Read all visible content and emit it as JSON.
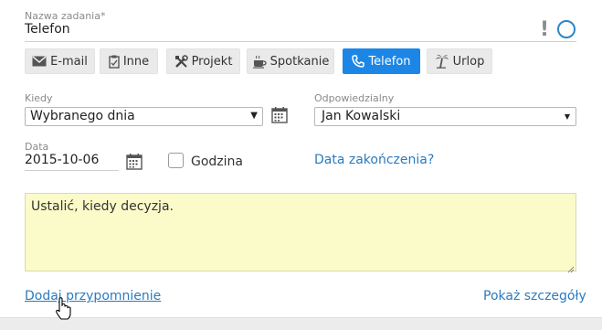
{
  "task": {
    "name_label": "Nazwa zadania*",
    "name_value": "Telefon",
    "priority_icon": "exclamation-icon",
    "status_icon": "circle-icon"
  },
  "types": [
    {
      "label": "E-mail",
      "icon": "envelope-icon",
      "active": false
    },
    {
      "label": "Inne",
      "icon": "clipboard-icon",
      "active": false
    },
    {
      "label": "Projekt",
      "icon": "tools-icon",
      "active": false
    },
    {
      "label": "Spotkanie",
      "icon": "coffee-icon",
      "active": false
    },
    {
      "label": "Telefon",
      "icon": "phone-icon",
      "active": true
    },
    {
      "label": "Urlop",
      "icon": "palm-tree-icon",
      "active": false
    }
  ],
  "when": {
    "label": "Kiedy",
    "value": "Wybranego dnia"
  },
  "responsible": {
    "label": "Odpowiedzialny",
    "value": "Jan Kowalski"
  },
  "date": {
    "label": "Data",
    "value": "2015-10-06"
  },
  "hour": {
    "label": "Godzina",
    "checked": false
  },
  "end_date_link": "Data zakończenia?",
  "note": "Ustalić, kiedy decyzja.",
  "links": {
    "add_reminder": "Dodaj przypomnienie",
    "show_details": "Pokaż szczegóły"
  },
  "colors": {
    "accent": "#1b86e6",
    "link": "#2a7bbf",
    "note_bg": "#fbfbc9"
  }
}
